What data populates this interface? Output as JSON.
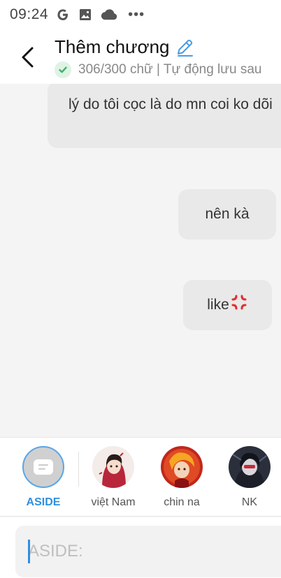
{
  "status_bar": {
    "time": "09:24",
    "icons": [
      "google-icon",
      "image-icon",
      "cloud-icon",
      "more-dots-icon"
    ],
    "dots": "•••"
  },
  "header": {
    "title": "Thêm chương",
    "subtitle": "306/300 chữ | Tự động lưu sau",
    "accent_color": "#2f8fe0",
    "check_color": "#3bb36a"
  },
  "messages": [
    {
      "text": "lý do tôi cọc là do mn coi ko dõi"
    },
    {
      "text": "nên kà"
    },
    {
      "text": "like",
      "emoji": "anger-symbol-icon"
    }
  ],
  "characters": [
    {
      "name": "ASIDE",
      "selected": true
    },
    {
      "name": "việt Nam"
    },
    {
      "name": "chin na"
    },
    {
      "name": "NK"
    }
  ],
  "input": {
    "placeholder": "ASIDE:",
    "value": ""
  }
}
